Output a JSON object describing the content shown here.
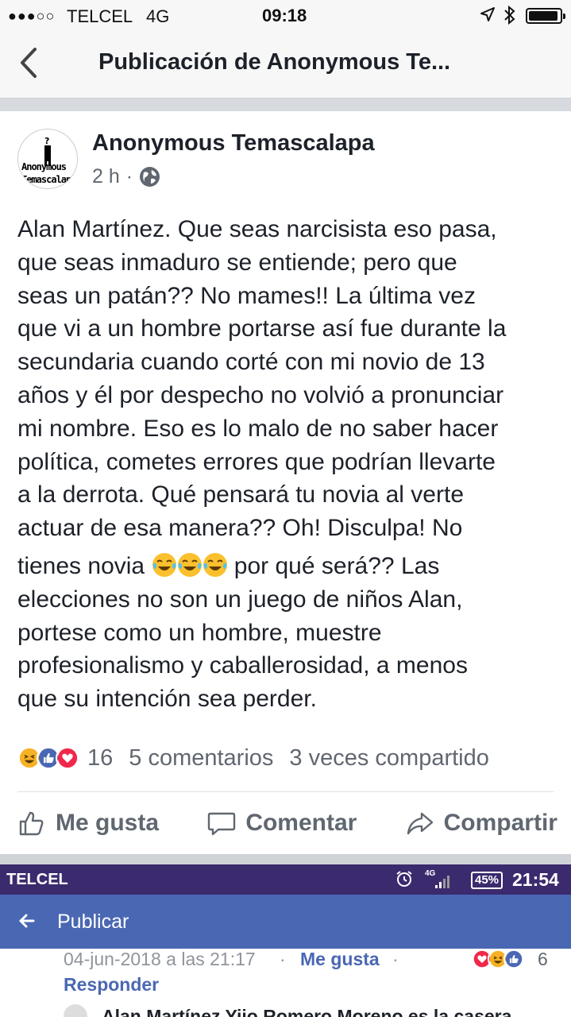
{
  "ios_status": {
    "signal": "●●●○○",
    "carrier": "TELCEL",
    "network": "4G",
    "time": "09:18"
  },
  "navbar": {
    "title": "Publicación de Anonymous Te..."
  },
  "post": {
    "avatar_text_1": "Anonymous",
    "avatar_text_2": "Temascalap",
    "author": "Anonymous Temascalapa",
    "time": "2 h",
    "separator": "·",
    "lines": [
      "Alan Martínez. Que seas narcisista eso pasa,",
      "que seas inmaduro se entiende; pero que",
      "seas un patán?? No mames!! La última vez",
      "que vi a un hombre portarse así fue durante la",
      "secundaria cuando corté con mi novio de 13",
      "años y él por despecho no volvió a pronunciar",
      "mi nombre. Eso es lo malo de no saber hacer",
      "política, cometes errores que podrían llevarte",
      "a la derrota. Qué pensará tu novia al verte",
      "actuar de esa manera?? Oh! Disculpa! No"
    ],
    "line_emoji_before": "tienes novia",
    "line_emoji_after": "por qué será?? Las",
    "lines_after": [
      "elecciones no son un juego de niños Alan,",
      "portese como un hombre, muestre",
      "profesionalismo y caballerosidad, a menos",
      "que su intención sea perder."
    ],
    "reaction_total": "16",
    "comments": "5 comentarios",
    "shares": "3 veces compartido",
    "actions": {
      "like": "Me gusta",
      "comment": "Comentar",
      "share": "Compartir"
    }
  },
  "embedded": {
    "status": {
      "carrier": "TELCEL",
      "net": "4G",
      "battery": "45%",
      "time": "21:54"
    },
    "bar_title": "Publicar",
    "comment": {
      "date": "04-jun-2018 a las 21:17",
      "dot": "·",
      "like": "Me gusta",
      "reactions": "6",
      "reply": "Responder",
      "next_comment": "Alan Martínez Yiio Romero Moreno es la casera"
    }
  },
  "colors": {
    "fb_text": "#1d2129",
    "muted": "#616770",
    "android_status": "#3b2a6e",
    "android_bar": "#4a67b3",
    "like_blue": "#4a67b3",
    "love_red": "#f0284a",
    "haha_yellow": "#f7b125"
  }
}
